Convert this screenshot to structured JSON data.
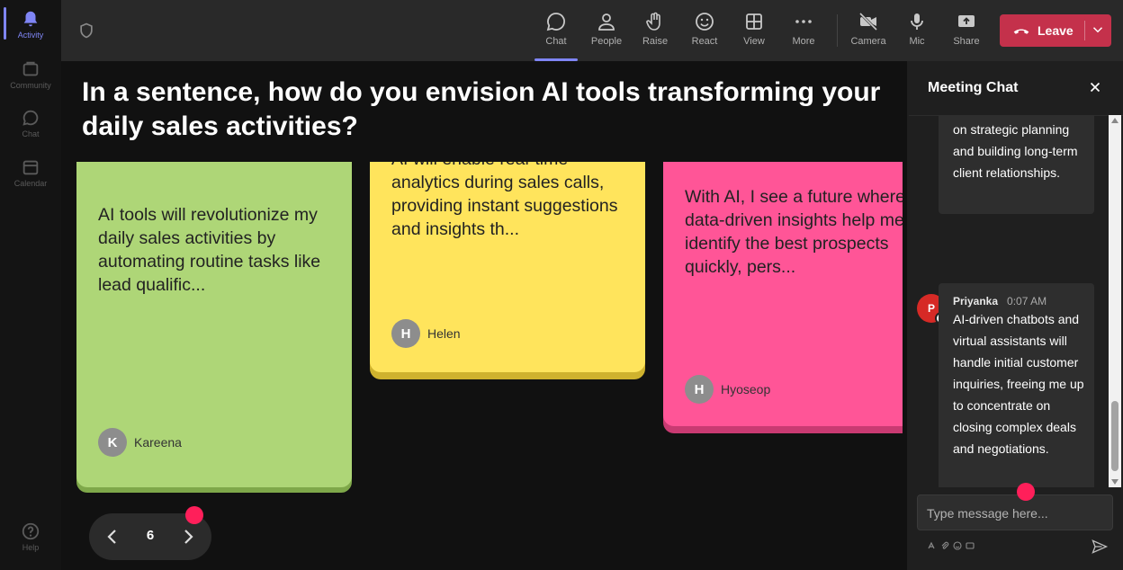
{
  "rail": {
    "items": [
      {
        "label": "Activity",
        "icon": "bell-icon",
        "active": true
      },
      {
        "label": "Community",
        "icon": "community-icon"
      },
      {
        "label": "Chat",
        "icon": "chat-icon"
      },
      {
        "label": "Calendar",
        "icon": "calendar-icon"
      }
    ],
    "help": "Help"
  },
  "toolbar": {
    "chat": "Chat",
    "people": "People",
    "raise": "Raise",
    "react": "React",
    "view": "View",
    "more": "More",
    "camera": "Camera",
    "mic": "Mic",
    "share": "Share",
    "leave": "Leave"
  },
  "question": "In a sentence, how do you envision AI tools transforming your daily sales activities?",
  "cards": [
    {
      "text": "AI tools will revolutionize my daily sales activities by automating routine tasks like lead qualific...",
      "author": "Kareena",
      "initial": "K",
      "color": "#aed677"
    },
    {
      "text": "AI will enable real-time analytics during sales calls, providing instant suggestions and insights th...",
      "author": "Helen",
      "initial": "H",
      "color": "#ffe45c"
    },
    {
      "text": "With AI, I see a future where data-driven insights help me identify the best prospects quickly, pers...",
      "author": "Hyoseop",
      "initial": "H",
      "color": "#ff5597"
    }
  ],
  "pager": {
    "page": "6"
  },
  "chat": {
    "title": "Meeting Chat",
    "messages": [
      {
        "text": "on strategic planning and building long-term client relationships."
      },
      {
        "sender": "Priyanka",
        "initial": "P",
        "time": "0:07 AM",
        "text": "AI-driven chatbots and virtual assistants will handle initial customer inquiries, freeing me up to concentrate on closing complex deals and negotiations."
      }
    ],
    "placeholder": "Type message here..."
  },
  "colors": {
    "accent": "#7f85f5",
    "leave": "#c4314b",
    "marker": "#ff1f5a"
  }
}
